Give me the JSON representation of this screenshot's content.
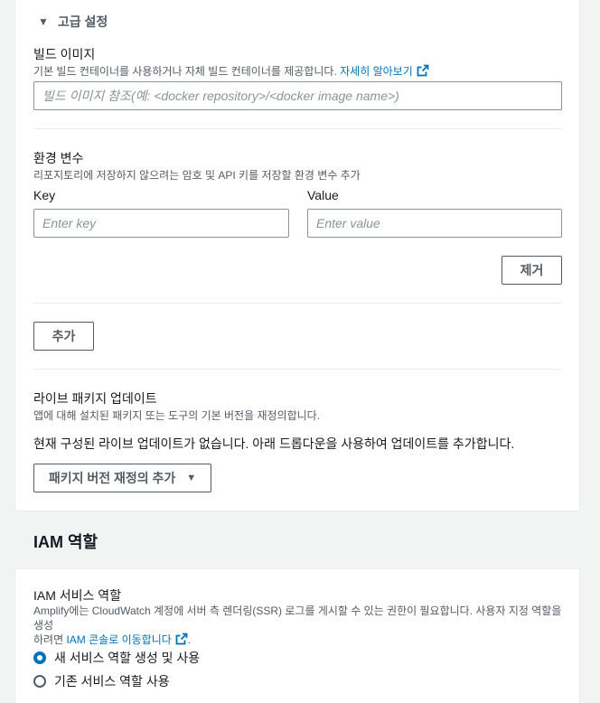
{
  "advanced": {
    "header_label": "고급 설정"
  },
  "build_image": {
    "label": "빌드 이미지",
    "description": "기본 빌드 컨테이너를 사용하거나 자체 빌드 컨테이너를 제공합니다.",
    "learn_more_link": "자세히 알아보기",
    "placeholder": "빌드 이미지 참조(예: <docker repository>/<docker image name>)"
  },
  "env_vars": {
    "label": "환경 변수",
    "description": "리포지토리에 저장하지 않으려는 암호 및 API 키를 저장할 환경 변수 추가",
    "key_label": "Key",
    "value_label": "Value",
    "key_placeholder": "Enter key",
    "value_placeholder": "Enter value",
    "remove_button": "제거",
    "add_button": "추가"
  },
  "live_packages": {
    "label": "라이브 패키지 업데이트",
    "description": "앱에 대해 설치된 패키지 또는 도구의 기본 버전을 재정의합니다.",
    "status_text": "현재 구성된 라이브 업데이트가 없습니다. 아래 드롭다운을 사용하여 업데이트를 추가합니다.",
    "dropdown_label": "패키지 버전 재정의 추가"
  },
  "iam": {
    "section_title": "IAM 역할",
    "label": "IAM 서비스 역할",
    "description_line1": "Amplify에는 CloudWatch 계정에 서버 측 렌더링(SSR) 로그를 게시할 수 있는 권한이 필요합니다. 사용자 지정 역할을 생성",
    "description_line2_prefix": "하려면 ",
    "description_link": "IAM 콘솔로 이동합니다",
    "description_line2_suffix": ".",
    "options": [
      "새 서비스 역할 생성 및 사용",
      "기존 서비스 역할 사용"
    ],
    "selected_option": "새 서비스 역할 생성 및 사용"
  },
  "colors": {
    "link": "#0073bb",
    "radio_selected": "#0073bb",
    "text": "#16191f",
    "muted": "#545b64"
  }
}
